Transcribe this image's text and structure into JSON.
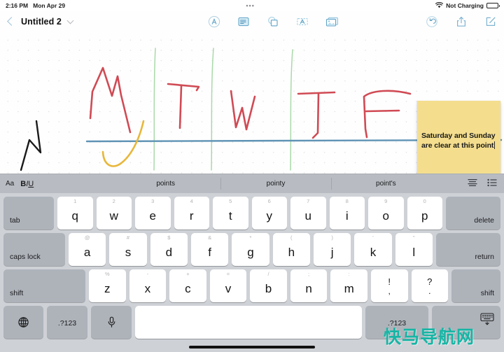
{
  "status_bar": {
    "time": "2:16 PM",
    "date": "Mon Apr 29",
    "center_dots": "•••",
    "wifi_icon": "wifi-icon",
    "charging_label": "Not Charging",
    "battery_icon": "battery-icon"
  },
  "nav": {
    "back_icon": "back-chevron-icon",
    "title": "Untitled 2",
    "title_chevron_icon": "chevron-down-icon",
    "center_tools": [
      {
        "name": "markup-tool",
        "icon": "circled-a-icon"
      },
      {
        "name": "note-tool",
        "icon": "note-lines-icon"
      },
      {
        "name": "shapes-tool",
        "icon": "shapes-icon"
      },
      {
        "name": "textbox-tool",
        "icon": "text-box-icon"
      },
      {
        "name": "photo-tool",
        "icon": "photo-icon"
      }
    ],
    "right_tools": [
      {
        "name": "undo-button",
        "icon": "undo-icon"
      },
      {
        "name": "share-button",
        "icon": "share-icon"
      },
      {
        "name": "compose-button",
        "icon": "compose-icon"
      }
    ]
  },
  "canvas": {
    "background": "dotted-grid",
    "handwriting": {
      "day_letters": [
        "M",
        "T",
        "W",
        "T",
        "F"
      ],
      "ink_color_letters": "#d04a54",
      "ink_color_dividers": "#a9d9a9",
      "ink_color_baseline": "#5f93b5",
      "ink_color_curve": "#e8b73a",
      "ink_color_mark": "#1a1a1a"
    }
  },
  "sticky_note": {
    "line1": "Saturday and Sunday",
    "line2": "are clear at this point",
    "color": "#f4de8e",
    "has_caret": true
  },
  "format_bar": {
    "font_size_label": "Aa",
    "bold_label": "B",
    "italic_label": "I",
    "underline_label": "U",
    "predictions": [
      "points",
      "pointy",
      "point's"
    ],
    "align_icon": "text-align-icon",
    "list_icon": "bullet-list-icon"
  },
  "keyboard": {
    "row1": {
      "tab": "tab",
      "keys": [
        {
          "main": "q",
          "hint": "1"
        },
        {
          "main": "w",
          "hint": "2"
        },
        {
          "main": "e",
          "hint": "3"
        },
        {
          "main": "r",
          "hint": "4"
        },
        {
          "main": "t",
          "hint": "5"
        },
        {
          "main": "y",
          "hint": "6"
        },
        {
          "main": "u",
          "hint": "7"
        },
        {
          "main": "i",
          "hint": "8"
        },
        {
          "main": "o",
          "hint": "9"
        },
        {
          "main": "p",
          "hint": "0"
        }
      ],
      "delete": "delete"
    },
    "row2": {
      "caps_lock": "caps lock",
      "keys": [
        {
          "main": "a",
          "hint": "@"
        },
        {
          "main": "s",
          "hint": "#"
        },
        {
          "main": "d",
          "hint": "$"
        },
        {
          "main": "f",
          "hint": "&"
        },
        {
          "main": "g",
          "hint": "*"
        },
        {
          "main": "h",
          "hint": "("
        },
        {
          "main": "j",
          "hint": ")"
        },
        {
          "main": "k",
          "hint": "'"
        },
        {
          "main": "l",
          "hint": "\""
        }
      ],
      "return": "return"
    },
    "row3": {
      "shift_left": "shift",
      "keys": [
        {
          "main": "z",
          "hint": "%"
        },
        {
          "main": "x",
          "hint": "-"
        },
        {
          "main": "c",
          "hint": "+"
        },
        {
          "main": "v",
          "hint": "="
        },
        {
          "main": "b",
          "hint": "/"
        },
        {
          "main": "n",
          "hint": ";"
        },
        {
          "main": "m",
          "hint": ":"
        }
      ],
      "dual_keys": [
        {
          "up": "!",
          "low": ","
        },
        {
          "up": "?",
          "low": "."
        }
      ],
      "shift_right": "shift"
    },
    "row4": {
      "globe_icon": "globe-icon",
      "numbers_left": ".?123",
      "mic_icon": "microphone-icon",
      "space": "",
      "numbers_right": ".?123",
      "dismiss_icon": "keyboard-dismiss-icon"
    }
  },
  "watermark": {
    "text": "快马导航网"
  }
}
